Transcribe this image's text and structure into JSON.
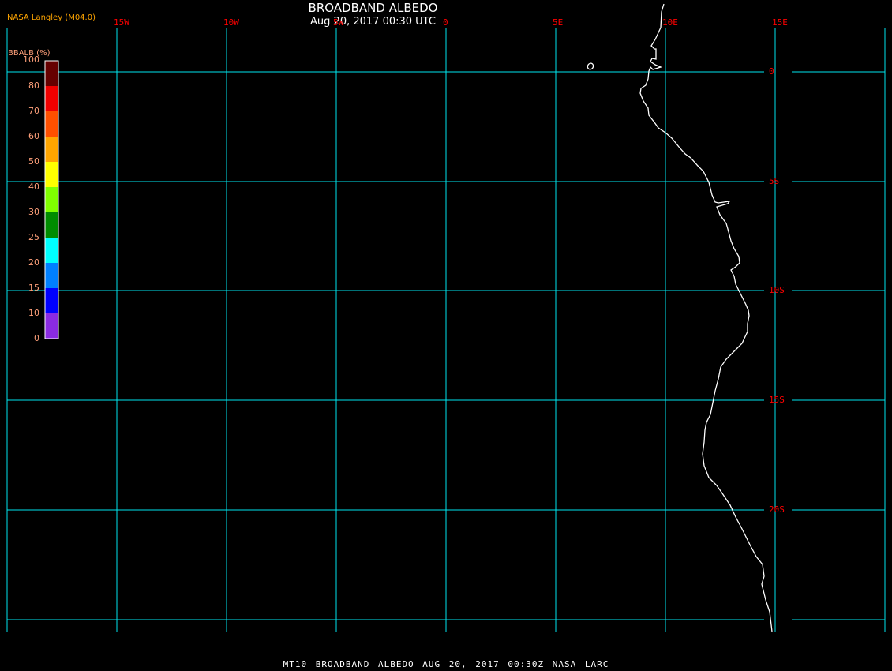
{
  "header": {
    "title": "BROADBAND ALBEDO",
    "subtitle": "Aug 20, 2017 00:30 UTC",
    "agency": "NASA Langley (M04.0)"
  },
  "footer": "MT10  BROADBAND ALBEDO   AUG 20, 2017 00:30Z   NASA LARC",
  "legend": {
    "title": "BBALB (%)",
    "ticks": [
      "100",
      "80",
      "70",
      "60",
      "50",
      "40",
      "30",
      "25",
      "20",
      "15",
      "10",
      "0"
    ],
    "colors": [
      "#660000",
      "#f00000",
      "#ff5000",
      "#ffa500",
      "#ffff00",
      "#80ff00",
      "#008c00",
      "#00ffff",
      "#0080ff",
      "#0000ff",
      "#8a2be2"
    ]
  },
  "map": {
    "lon_labels": [
      "15W",
      "10W",
      "5W",
      "0",
      "5E",
      "10E",
      "15E"
    ],
    "lat_labels": [
      "0",
      "5S",
      "10S",
      "15S",
      "20S"
    ],
    "grid_color": "#00e5ee",
    "coast_color": "#ffffff",
    "label_color": "#ff0000"
  }
}
